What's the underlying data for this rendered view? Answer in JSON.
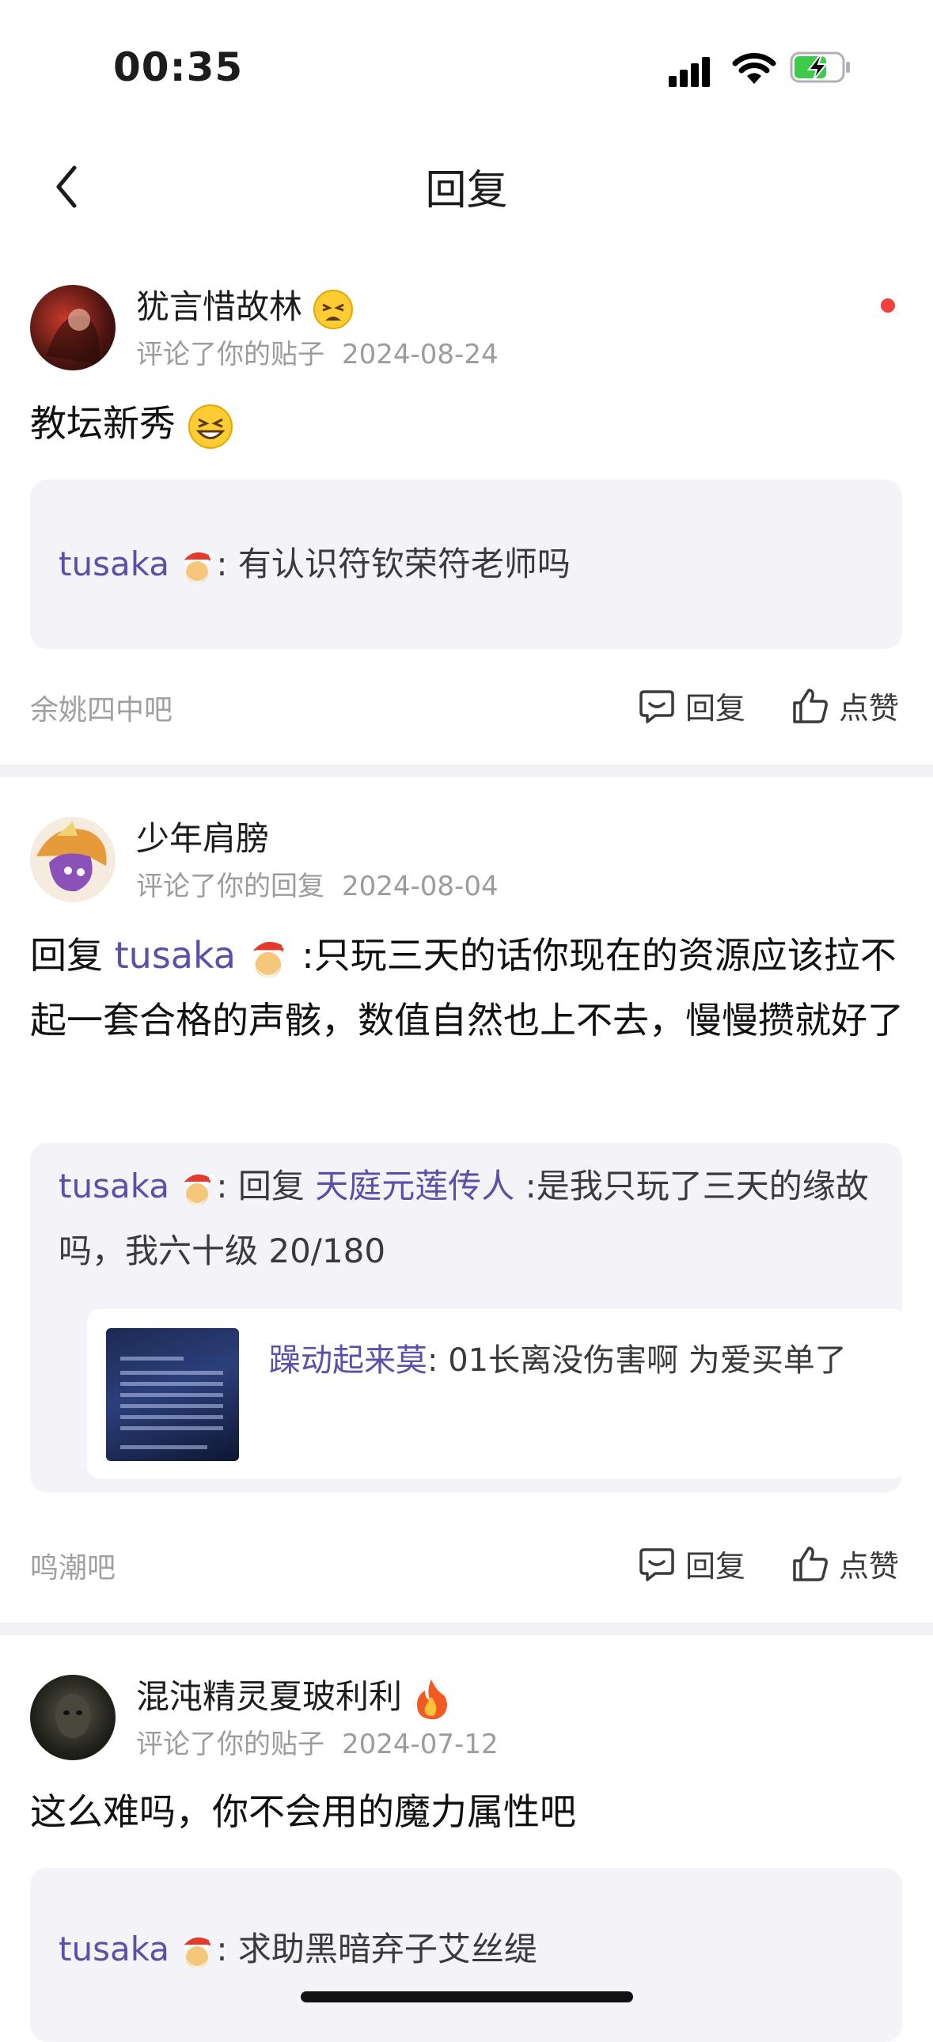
{
  "status_bar": {
    "time": "00:35",
    "battery_state": "charging",
    "accent": "#3fcb4a"
  },
  "nav": {
    "title": "回复"
  },
  "notifications": [
    {
      "user": "犹言惜故林",
      "user_badge": "tired-face-emoji",
      "action": "评论了你的贴子",
      "date": "2024-08-24",
      "content": "教坛新秀",
      "content_emoji": "squinting-laugh-emoji",
      "quote": {
        "author": "tusaka",
        "separator": ":",
        "text": " 有认识符钦荣符老师吗"
      },
      "forum": "余姚四中吧",
      "reply_label": "回复",
      "like_label": "点赞",
      "unread": true
    },
    {
      "user": "少年肩膀",
      "action": "评论了你的回复",
      "date": "2024-08-04",
      "content_prefix": "回复 ",
      "content_mention": "tusaka",
      "content": " :只玩三天的话你现在的资源应该拉不起一套合格的声骸，数值自然也上不去，慢慢攒就好了",
      "quote": {
        "author": "tusaka",
        "separator": ":",
        "prefix": " 回复 ",
        "mention": "天庭元莲传人",
        "text": " :是我只玩了三天的缘故吗，我六十级 20/180"
      },
      "inner_quote": {
        "author": "躁动起来莫",
        "separator": ":",
        "text": " 01长离没伤害啊 为爱买单了"
      },
      "forum": "鸣潮吧",
      "reply_label": "回复",
      "like_label": "点赞"
    },
    {
      "user": "混沌精灵夏玻利利",
      "user_badge": "fire-emoji",
      "action": "评论了你的贴子",
      "date": "2024-07-12",
      "content": "这么难吗，你不会用的魔力属性吧",
      "quote": {
        "author": "tusaka",
        "separator": ":",
        "text": " 求助黑暗弃子艾丝缇"
      }
    }
  ],
  "colors": {
    "mention": "#5b4fa8",
    "meta": "#9b9ba0",
    "quote_bg": "#f3f3f8",
    "unread": "#f0413a"
  }
}
